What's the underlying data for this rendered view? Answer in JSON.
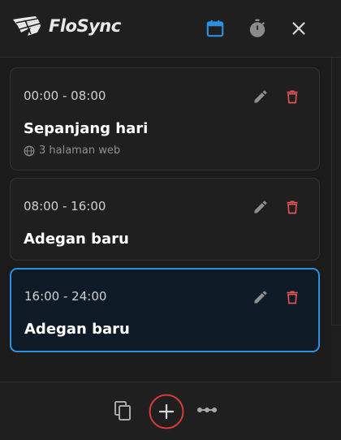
{
  "app": {
    "title": "FloSync",
    "accent": "#2e8fe0",
    "danger": "#e05252"
  },
  "header": {
    "icons": [
      "calendar-icon",
      "timer-icon",
      "close-icon"
    ]
  },
  "scenes": [
    {
      "time": "00:00 - 08:00",
      "name": "Sepanjang hari",
      "meta": "3 halaman web",
      "active": false
    },
    {
      "time": "08:00 - 16:00",
      "name": "Adegan baru",
      "meta": "",
      "active": false
    },
    {
      "time": "16:00 - 24:00",
      "name": "Adegan baru",
      "meta": "",
      "active": true
    }
  ],
  "footer": {
    "icons": [
      "copy-icon",
      "add-icon",
      "more-icon"
    ]
  }
}
